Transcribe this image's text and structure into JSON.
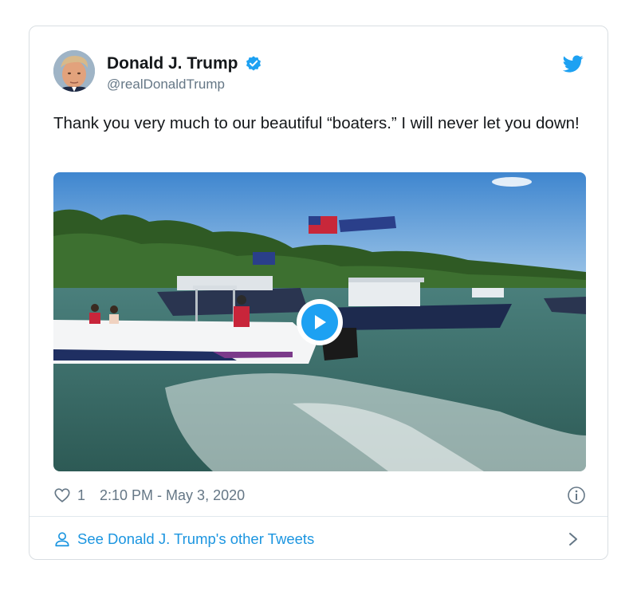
{
  "tweet": {
    "display_name": "Donald J. Trump",
    "handle": "@realDonaldTrump",
    "verified": true,
    "text": "Thank you very much to our beautiful “boaters.” I will never let you down!",
    "media_type": "video",
    "like_count": "1",
    "timestamp": "2:10 PM - May 3, 2020"
  },
  "footer": {
    "link_label": "See Donald J. Trump's other Tweets"
  },
  "icons": {
    "brand": "twitter-bird-icon",
    "verified": "verified-badge-icon",
    "like": "heart-icon",
    "info": "info-icon",
    "profile": "person-icon",
    "more": "chevron-right-icon",
    "play": "play-icon"
  },
  "colors": {
    "accent": "#1da1f2",
    "link": "#1b95e0",
    "text": "#14171a",
    "muted": "#657786",
    "border": "#d9dee2"
  }
}
